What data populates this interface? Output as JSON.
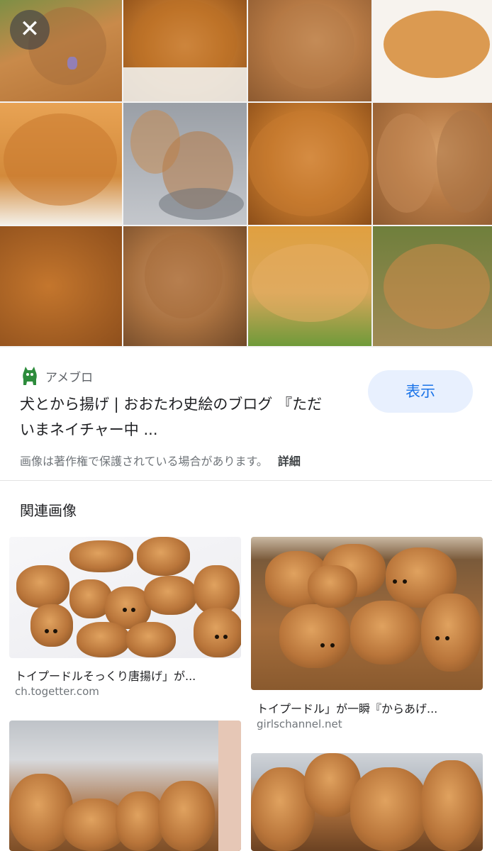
{
  "hero": {
    "close_icon": "close-icon",
    "close_glyph": "✕"
  },
  "result": {
    "source_icon": "ameba-icon",
    "source_name": "アメブロ",
    "title": "犬とから揚げ | おおたわ史絵のブログ 『ただいまネイチャー中 ...",
    "show_button": "表示",
    "copyright_notice": "画像は著作権で保護されている場合があります。",
    "details_link": "詳細"
  },
  "related": {
    "heading": "関連画像",
    "items": [
      {
        "title": "トイプードルそっくり唐揚げ」が...",
        "domain": "ch.togetter.com"
      },
      {
        "title": "トイプードル」が一瞬『からあげ...",
        "domain": "girlschannel.net"
      },
      {
        "title": "",
        "domain": ""
      },
      {
        "title": "",
        "domain": ""
      }
    ]
  },
  "colors": {
    "accent": "#1a73e8",
    "button_bg": "#e8f0fe",
    "secondary_text": "#70757a",
    "ameba_green": "#2d8c3c"
  }
}
